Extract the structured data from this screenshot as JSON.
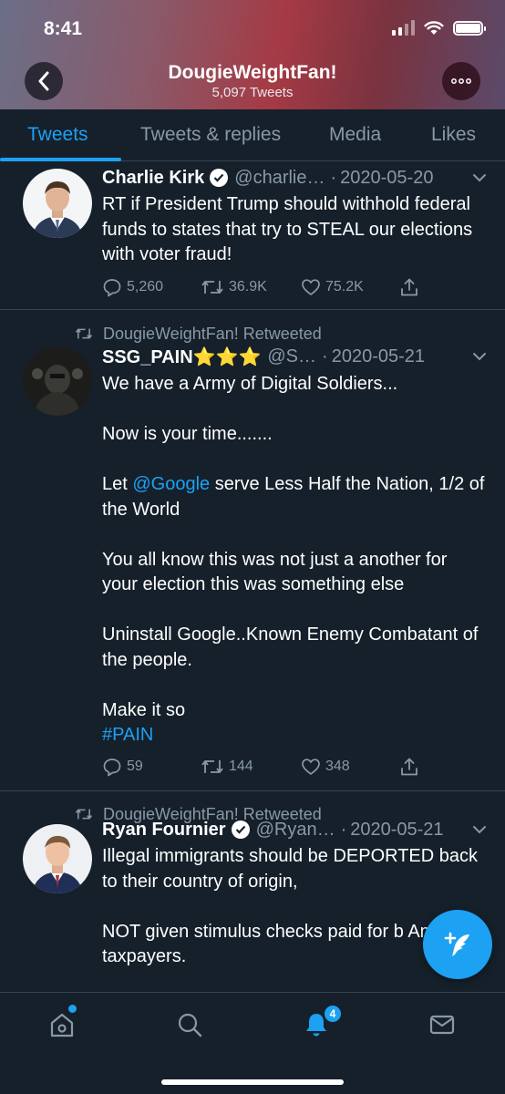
{
  "status_bar": {
    "time": "8:41"
  },
  "profile": {
    "name": "DougieWeightFan!",
    "tweet_count": "5,097 Tweets"
  },
  "tabs": [
    {
      "label": "Tweets",
      "active": true
    },
    {
      "label": "Tweets & replies",
      "active": false
    },
    {
      "label": "Media",
      "active": false
    },
    {
      "label": "Likes",
      "active": false
    }
  ],
  "tweets": [
    {
      "author": "Charlie Kirk",
      "verified": true,
      "handle": "@charlie…",
      "date": "2020-05-20",
      "text": "RT if President Trump should withhold federal funds to states that try to STEAL our elections with voter fraud!",
      "replies": "5,260",
      "retweets": "36.9K",
      "likes": "75.2K"
    },
    {
      "retweeted_by": "DougieWeightFan! Retweeted",
      "author": "SSG_PAIN⭐⭐⭐",
      "handle": "@S…",
      "date": "2020-05-21",
      "text": {
        "p1": "We have a Army of Digital Soldiers...",
        "p2": "Now is your time.......",
        "p3_pre": "Let ",
        "p3_mention": "@Google",
        "p3_post": " serve Less Half the Nation, 1/2 of the World",
        "p4": "You all know this was not just a another for your election this was something else",
        "p5": "Uninstall Google..Known Enemy Combatant of the people.",
        "p6": "Make it so",
        "p6_hashtag": "#PAIN"
      },
      "replies": "59",
      "retweets": "144",
      "likes": "348"
    },
    {
      "retweeted_by": "DougieWeightFan! Retweeted",
      "author": "Ryan Fournier",
      "verified": true,
      "handle": "@Ryan…",
      "date": "2020-05-21",
      "text": {
        "p1": "Illegal immigrants should be DEPORTED back to their country of origin,",
        "p2": "NOT given stimulus checks paid for b American taxpayers."
      }
    }
  ],
  "bottom_nav": {
    "notifications_badge": "4"
  },
  "colors": {
    "accent": "#1da1f2",
    "background": "#15202b",
    "muted": "#8899a6",
    "divider": "#38444d"
  }
}
